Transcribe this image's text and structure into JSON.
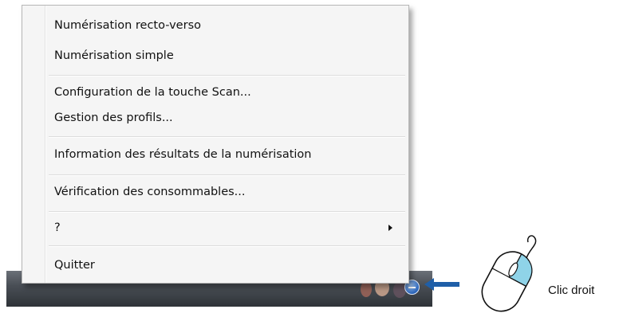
{
  "context_menu": {
    "items": [
      {
        "label": "Numérisation recto-verso"
      },
      {
        "label": "Numérisation simple"
      },
      {
        "label": "Configuration de la touche Scan..."
      },
      {
        "label": "Gestion des profils..."
      },
      {
        "label": "Information des résultats de la numérisation"
      },
      {
        "label": "Vérification des consommables..."
      },
      {
        "label": "?",
        "has_submenu": true
      },
      {
        "label": "Quitter"
      }
    ]
  },
  "taskbar": {
    "tray_icon": "scanner-tray-icon"
  },
  "annotation": {
    "caption": "Clic droit",
    "arrow_icon": "left-arrow-icon",
    "mouse_icon": "mouse-right-click-icon",
    "arrow_color": "#1f5fa8",
    "highlight_color": "#8fd3e8"
  }
}
